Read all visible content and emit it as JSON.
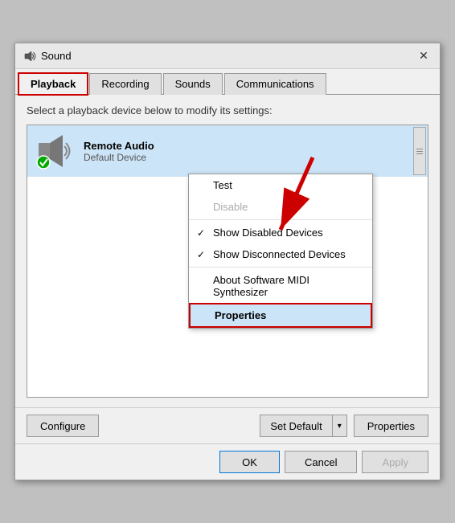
{
  "title": "Sound",
  "close_btn": "✕",
  "tabs": [
    {
      "id": "playback",
      "label": "Playback",
      "active": true
    },
    {
      "id": "recording",
      "label": "Recording",
      "active": false
    },
    {
      "id": "sounds",
      "label": "Sounds",
      "active": false
    },
    {
      "id": "communications",
      "label": "Communications",
      "active": false
    }
  ],
  "content": {
    "description": "Select a playback device below to modify its settings:",
    "device": {
      "name": "Remote Audio",
      "status": "Default Device"
    }
  },
  "context_menu": {
    "items": [
      {
        "id": "test",
        "label": "Test",
        "disabled": false,
        "checked": false,
        "highlighted": false
      },
      {
        "id": "disable",
        "label": "Disable",
        "disabled": true,
        "checked": false,
        "highlighted": false
      },
      {
        "id": "sep1",
        "separator": true
      },
      {
        "id": "show-disabled",
        "label": "Show Disabled Devices",
        "checked": true,
        "disabled": false,
        "highlighted": false
      },
      {
        "id": "show-disconnected",
        "label": "Show Disconnected Devices",
        "checked": true,
        "disabled": false,
        "highlighted": false
      },
      {
        "id": "sep2",
        "separator": true
      },
      {
        "id": "about-midi",
        "label": "About Software MIDI Synthesizer",
        "disabled": false,
        "checked": false,
        "highlighted": false
      },
      {
        "id": "properties",
        "label": "Properties",
        "disabled": false,
        "checked": false,
        "highlighted": true
      }
    ]
  },
  "bottom_buttons": {
    "configure": "Configure",
    "set_default": "Set Default",
    "set_default_arrow": "▾",
    "properties": "Properties"
  },
  "footer_buttons": {
    "ok": "OK",
    "cancel": "Cancel",
    "apply": "Apply"
  }
}
